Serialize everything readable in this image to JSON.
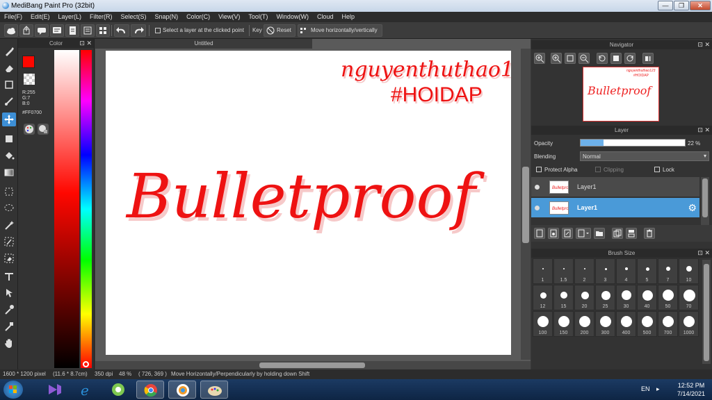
{
  "app": {
    "title": "MediBang Paint Pro (32bit)"
  },
  "window_controls": {
    "minimize": "—",
    "restore": "❐",
    "close": "✕"
  },
  "menu": [
    "File(F)",
    "Edit(E)",
    "Layer(L)",
    "Filter(R)",
    "Select(S)",
    "Snap(N)",
    "Color(C)",
    "View(V)",
    "Tool(T)",
    "Window(W)",
    "Cloud",
    "Help"
  ],
  "toolbar": {
    "select_layer_label": "Select a layer at the clicked point",
    "key_label": "Key",
    "reset_label": "Reset",
    "move_label": "Move horizontally/vertically"
  },
  "color_panel": {
    "title": "Color",
    "r": "R:255",
    "g": "G:7",
    "b": "B:0",
    "hex": "#FF0700",
    "fg_color": "#ff0700"
  },
  "document": {
    "tab_title": "Untitled",
    "main_text": "Bulletproof",
    "signature_line1": "nguyenthuthao123",
    "signature_line2": "#HOIDAP",
    "ink_color": "#ee1212",
    "shadow_color": "#f6c9c9"
  },
  "navigator": {
    "title": "Navigator",
    "thumb_text": "Bulletproof",
    "thumb_sig1": "nguyenthuthao123",
    "thumb_sig2": "#HOIDAP"
  },
  "layer_panel": {
    "title": "Layer",
    "opacity_label": "Opacity",
    "opacity_value": "22 %",
    "opacity_fraction": 0.22,
    "blending_label": "Blending",
    "blending_value": "Normal",
    "protect_alpha": "Protect Alpha",
    "clipping": "Clipping",
    "lock": "Lock",
    "layers": [
      {
        "name": "Layer1",
        "selected": false
      },
      {
        "name": "Layer1",
        "selected": true
      }
    ]
  },
  "brush_panel": {
    "title": "Brush Size",
    "sizes": [
      "1",
      "1.5",
      "2",
      "3",
      "4",
      "5",
      "7",
      "10",
      "12",
      "15",
      "20",
      "25",
      "30",
      "40",
      "50",
      "70",
      "100",
      "150",
      "200",
      "300",
      "400",
      "500",
      "700",
      "1000"
    ]
  },
  "status": {
    "size": "1600 * 1200 pixel",
    "physical": "(11.6 * 8.7cm)",
    "dpi": "350 dpi",
    "zoom": "48 %",
    "coords": "( 726, 369 )",
    "hint": "Move Horizontally/Perpendicularly by holding down Shift"
  },
  "taskbar": {
    "lang": "EN",
    "time": "12:52 PM",
    "date": "7/14/2021"
  }
}
